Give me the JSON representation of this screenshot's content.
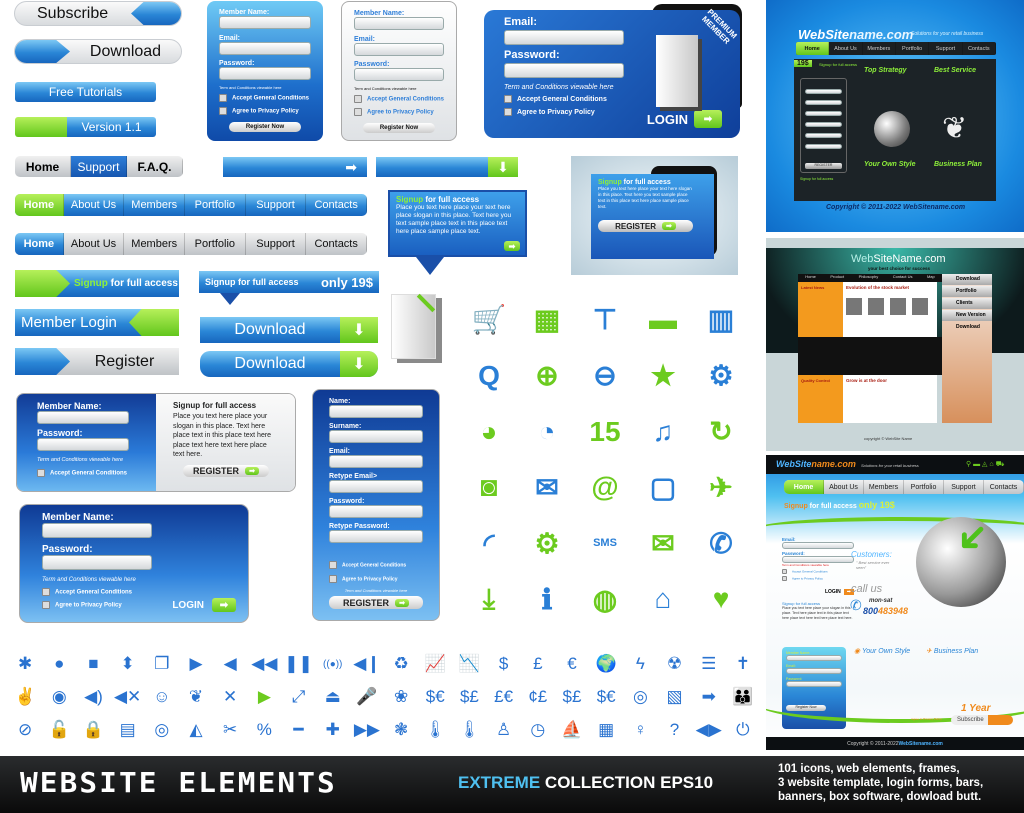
{
  "buttons": {
    "subscribe": "Subscribe",
    "download_pill": "Download",
    "free_tutorials": "Free Tutorials",
    "version": "Version 1.1",
    "member_login": "Member Login",
    "register": "Register",
    "signup_green": "Signup",
    "signup_rest": " for full access",
    "signup_banner": "Signup for full access",
    "only_price": "only 19$",
    "download_a": "Download",
    "download_b": "Download"
  },
  "mini_nav": [
    "Home",
    "Support",
    "F.A.Q."
  ],
  "nav_green": [
    "Home",
    "About Us",
    "Members",
    "Portfolio",
    "Support",
    "Contacts"
  ],
  "nav_grey": [
    "Home",
    "About Us",
    "Members",
    "Portfolio",
    "Support",
    "Contacts"
  ],
  "form_blue": {
    "labels": [
      "Member Name:",
      "Email:",
      "Password:"
    ],
    "terms": "Term and Conditions viewable here",
    "checks": [
      "Accept General Conditions",
      "Agree to Privacy Policy"
    ],
    "button": "Register  Now"
  },
  "form_grey": {
    "labels": [
      "Member Name:",
      "Email:",
      "Password:"
    ],
    "terms": "Term and Conditions viewable here",
    "checks": [
      "Accept General Conditions",
      "Agree to Privacy Policy"
    ],
    "button": "Register  Now"
  },
  "premium_form": {
    "labels": [
      "Email:",
      "Password:"
    ],
    "terms": "Term and Conditions viewable here",
    "checks": [
      "Accept General Conditions",
      "Agree to Privacy Policy"
    ],
    "button": "LOGIN",
    "ribbon": "PREMIUM MEMBER"
  },
  "bubble": {
    "title_green": "Signup",
    "title_rest": " for full access",
    "body": "Place you text here place your text here place slogan in this place. Text here you text sample place text in this place text here place sample place text."
  },
  "framed_banner": {
    "title_green": "Signup",
    "title_rest": " for full access",
    "body": "Place you text here place your text here slogan in this place. Text here you text sample place text in this place text here place sample place text.",
    "button": "REGISTER"
  },
  "combo_form": {
    "labels": [
      "Member Name:",
      "Password:"
    ],
    "terms": "Term and Conditions viewable here",
    "check": "Accept General Conditions",
    "title": "Signup for full access",
    "body": "Place you text here place your slogan in this place. Text here place text in this place text here place text here text here place text here.",
    "button": "REGISTER"
  },
  "login_form": {
    "labels": [
      "Member Name:",
      "Password:"
    ],
    "terms": "Term and Conditions viewable here",
    "checks": [
      "Accept General Conditions",
      "Agree to Privacy Policy"
    ],
    "button": "LOGIN"
  },
  "register_form": {
    "labels": [
      "Name:",
      "Surname:",
      "Email:",
      "Retype Email>",
      "Password:",
      "Retype Password:"
    ],
    "checks": [
      "Accept General Conditions",
      "Agree to Privacy Policy"
    ],
    "terms": "Term and Conditions viewable here",
    "button": "REGISTER"
  },
  "big_icons": [
    {
      "name": "cart-icon",
      "glyph": "🛒",
      "color": "blue"
    },
    {
      "name": "calculator-icon",
      "glyph": "▦",
      "color": "green"
    },
    {
      "name": "sitemap-icon",
      "glyph": "⊤",
      "color": "blue"
    },
    {
      "name": "folder-icon",
      "glyph": "▬",
      "color": "green"
    },
    {
      "name": "trash-icon",
      "glyph": "▥",
      "color": "blue"
    },
    {
      "name": "zoom-icon",
      "glyph": "Q",
      "color": "blue"
    },
    {
      "name": "zoom-in-icon",
      "glyph": "⊕",
      "color": "green"
    },
    {
      "name": "zoom-out-icon",
      "glyph": "⊖",
      "color": "blue"
    },
    {
      "name": "star-icon",
      "glyph": "★",
      "color": "green"
    },
    {
      "name": "gears-icon",
      "glyph": "⚙",
      "color": "blue"
    },
    {
      "name": "pie-chart-icon",
      "glyph": "◕",
      "color": "green"
    },
    {
      "name": "pie-chart-exploded-icon",
      "glyph": "◔",
      "color": "blue"
    },
    {
      "name": "calendar-icon",
      "glyph": "15",
      "color": "green"
    },
    {
      "name": "music-note-icon",
      "glyph": "♫",
      "color": "blue"
    },
    {
      "name": "refresh-icon",
      "glyph": "↻",
      "color": "green"
    },
    {
      "name": "camera-icon",
      "glyph": "◙",
      "color": "green"
    },
    {
      "name": "open-envelope-icon",
      "glyph": "✉",
      "color": "blue"
    },
    {
      "name": "at-sign-icon",
      "glyph": "@",
      "color": "green"
    },
    {
      "name": "tv-icon",
      "glyph": "▢",
      "color": "blue"
    },
    {
      "name": "airplane-icon",
      "glyph": "✈",
      "color": "green"
    },
    {
      "name": "rss-icon",
      "glyph": "◜",
      "color": "blue"
    },
    {
      "name": "gear-icon",
      "glyph": "⚙",
      "color": "green"
    },
    {
      "name": "sms-icon",
      "glyph": "SMS",
      "color": "blue"
    },
    {
      "name": "envelope-icon",
      "glyph": "✉",
      "color": "green"
    },
    {
      "name": "phone-icon",
      "glyph": "✆",
      "color": "blue"
    },
    {
      "name": "download-icon",
      "glyph": "⤓",
      "color": "green"
    },
    {
      "name": "info-icon",
      "glyph": "ℹ",
      "color": "blue"
    },
    {
      "name": "globe-icon",
      "glyph": "◍",
      "color": "green"
    },
    {
      "name": "home-icon",
      "glyph": "⌂",
      "color": "blue"
    },
    {
      "name": "heart-icon",
      "glyph": "♥",
      "color": "green"
    }
  ],
  "small_icons": [
    [
      {
        "name": "flower-icon",
        "glyph": "✱"
      },
      {
        "name": "record-icon",
        "glyph": "●"
      },
      {
        "name": "stop-icon",
        "glyph": "■"
      },
      {
        "name": "up-down-icon",
        "glyph": "⬍"
      },
      {
        "name": "copy-icon",
        "glyph": "❐"
      },
      {
        "name": "play-icon",
        "glyph": "▶"
      },
      {
        "name": "back-icon",
        "glyph": "◀"
      },
      {
        "name": "rewind-icon",
        "glyph": "◀◀"
      },
      {
        "name": "pause-icon",
        "glyph": "❚❚"
      },
      {
        "name": "broadcast-icon",
        "glyph": "((●))"
      },
      {
        "name": "prev-icon",
        "glyph": "◀❙"
      },
      {
        "name": "recycle-icon",
        "glyph": "♻"
      },
      {
        "name": "chart-up-icon",
        "glyph": "📈"
      },
      {
        "name": "chart-down-icon",
        "glyph": "📉"
      },
      {
        "name": "dollar-icon",
        "glyph": "$"
      },
      {
        "name": "pound-icon",
        "glyph": "£"
      },
      {
        "name": "euro-icon",
        "glyph": "€"
      },
      {
        "name": "world-map-icon",
        "glyph": "🌍"
      },
      {
        "name": "lightning-icon",
        "glyph": "ϟ"
      },
      {
        "name": "radiation-icon",
        "glyph": "☢"
      },
      {
        "name": "list-icon",
        "glyph": "☰"
      },
      {
        "name": "cross-icon",
        "glyph": "✝"
      }
    ],
    [
      {
        "name": "person-jump-icon",
        "glyph": "✌"
      },
      {
        "name": "disc-icon",
        "glyph": "◉"
      },
      {
        "name": "volume-icon",
        "glyph": "◀)"
      },
      {
        "name": "mute-icon",
        "glyph": "◀✕"
      },
      {
        "name": "smiley-icon",
        "glyph": "☺"
      },
      {
        "name": "leaf-icon",
        "glyph": "❦"
      },
      {
        "name": "close-icon",
        "glyph": "✕"
      },
      {
        "name": "play-green-icon",
        "glyph": "▶"
      },
      {
        "name": "resize-icon",
        "glyph": "⤢"
      },
      {
        "name": "lamp-icon",
        "glyph": "⏏"
      },
      {
        "name": "microphone-icon",
        "glyph": "🎤"
      },
      {
        "name": "plant-icon",
        "glyph": "❀"
      },
      {
        "name": "exchange-euro-icon",
        "glyph": "$€"
      },
      {
        "name": "exchange-pound-icon",
        "glyph": "$£"
      },
      {
        "name": "exchange-euro-pound-icon",
        "glyph": "£€"
      },
      {
        "name": "exchange-yen-icon",
        "glyph": "¢£"
      },
      {
        "name": "exchange-dollar-pound-icon",
        "glyph": "$£"
      },
      {
        "name": "exchange-dollar-euro-icon",
        "glyph": "$€"
      },
      {
        "name": "target-icon",
        "glyph": "◎"
      },
      {
        "name": "solar-panel-icon",
        "glyph": "▧"
      },
      {
        "name": "arrow-right-icon",
        "glyph": "➡"
      },
      {
        "name": "people-icon",
        "glyph": "👪"
      }
    ],
    [
      {
        "name": "no-entry-icon",
        "glyph": "⊘"
      },
      {
        "name": "unlock-icon",
        "glyph": "🔓"
      },
      {
        "name": "lock-icon",
        "glyph": "🔒"
      },
      {
        "name": "document-icon",
        "glyph": "▤"
      },
      {
        "name": "cd-icon",
        "glyph": "◎"
      },
      {
        "name": "mirror-icon",
        "glyph": "◭"
      },
      {
        "name": "tools-icon",
        "glyph": "✂"
      },
      {
        "name": "percent-icon",
        "glyph": "%"
      },
      {
        "name": "minus-icon",
        "glyph": "━"
      },
      {
        "name": "plus-icon",
        "glyph": "✚"
      },
      {
        "name": "fast-forward-icon",
        "glyph": "▶▶"
      },
      {
        "name": "tree-icon",
        "glyph": "❃"
      },
      {
        "name": "thermometer-icon",
        "glyph": "🌡"
      },
      {
        "name": "thermometer-empty-icon",
        "glyph": "🌡"
      },
      {
        "name": "child-icon",
        "glyph": "♙"
      },
      {
        "name": "clock-icon",
        "glyph": "◷"
      },
      {
        "name": "sailboat-icon",
        "glyph": "⛵"
      },
      {
        "name": "film-icon",
        "glyph": "▦"
      },
      {
        "name": "person-icon",
        "glyph": "♀"
      },
      {
        "name": "question-icon",
        "glyph": "?"
      },
      {
        "name": "left-right-icon",
        "glyph": "◀▶"
      },
      {
        "name": "power-icon",
        "glyph": "⏻"
      }
    ]
  ],
  "template1": {
    "logo_a": "WebSite",
    "logo_b": "name.com",
    "tagline": "Solutions for your retail business",
    "nav": [
      "Home",
      "About Us",
      "Members",
      "Portfolio",
      "Support",
      "Contacts"
    ],
    "price": "19$",
    "signup": "Signup for full access",
    "register": "REGISTER",
    "headings": [
      "Top Strategy",
      "Best Service",
      "Your Own Style",
      "Business Plan"
    ],
    "sidebar_title": "Signup for full access",
    "copyright": "Copyright © 2011-2022  WebSitename.com"
  },
  "template2": {
    "logo_a": "Web",
    "logo_b": "SiteName.com",
    "tagline": "your best choice for success",
    "nav": [
      "Home",
      "Product",
      "Philosophy",
      "Contact Us",
      "Map"
    ],
    "side_menu": [
      "Download",
      "Portfolio",
      "Clients",
      "New Version",
      "Download"
    ],
    "latest_news": "Latest News",
    "quality_control": "Quality Control",
    "article1": "Evolution of the stock market",
    "article2": "Grow is at the door",
    "footer": "copyright © WebSite Name"
  },
  "template3": {
    "logo_a": "WebSite",
    "logo_b": "name.com",
    "tagline": "Solutions for your retail business",
    "nav": [
      "Home",
      "About Us",
      "Members",
      "Portfolio",
      "Support",
      "Contacts"
    ],
    "signup_a": "Signup",
    "signup_b": " for full access ",
    "signup_price": "only 19$",
    "email": "Email:",
    "password": "Password:",
    "terms": "Term and Conditions viewable here",
    "checks": [
      "Accept General Conditions",
      "Agree to Privacy Policy"
    ],
    "login": "LOGIN",
    "customers": "Customers:",
    "quote": "\" Best service ever seen\"",
    "call_us": "call us",
    "hours": "mon-sat",
    "phone_a": "800",
    "phone_b": "483948",
    "signup_title": "Signup for full access",
    "signup_body": "Place you text here place your slogan in this place. Text here place text in this place text here place text here text here place text here.",
    "headings": [
      "Your Own Style",
      "Business Plan"
    ],
    "box_labels": [
      "Member Name:",
      "Email:",
      "Password:"
    ],
    "register": "Register  Now",
    "year": "1 Year",
    "subscribe": "Subscribe",
    "privacy": "Agree to Privacy Policy",
    "copyright_a": "Copyright © 2011-2022  ",
    "copyright_b": "WebSitename.com"
  },
  "footer": {
    "title": "WEBSITE ELEMENTS",
    "extreme": "EXTREME",
    "collection": " COLLECTION EPS10",
    "desc": [
      "101 icons, web elements, frames,",
      "3 website template, login forms, bars,",
      "banners, box software, dowload butt."
    ]
  },
  "colors": {
    "blue": "#2a86d6",
    "green": "#6ccb1f",
    "dark_blue": "#1a4fa8",
    "orange": "#f08a1c"
  }
}
